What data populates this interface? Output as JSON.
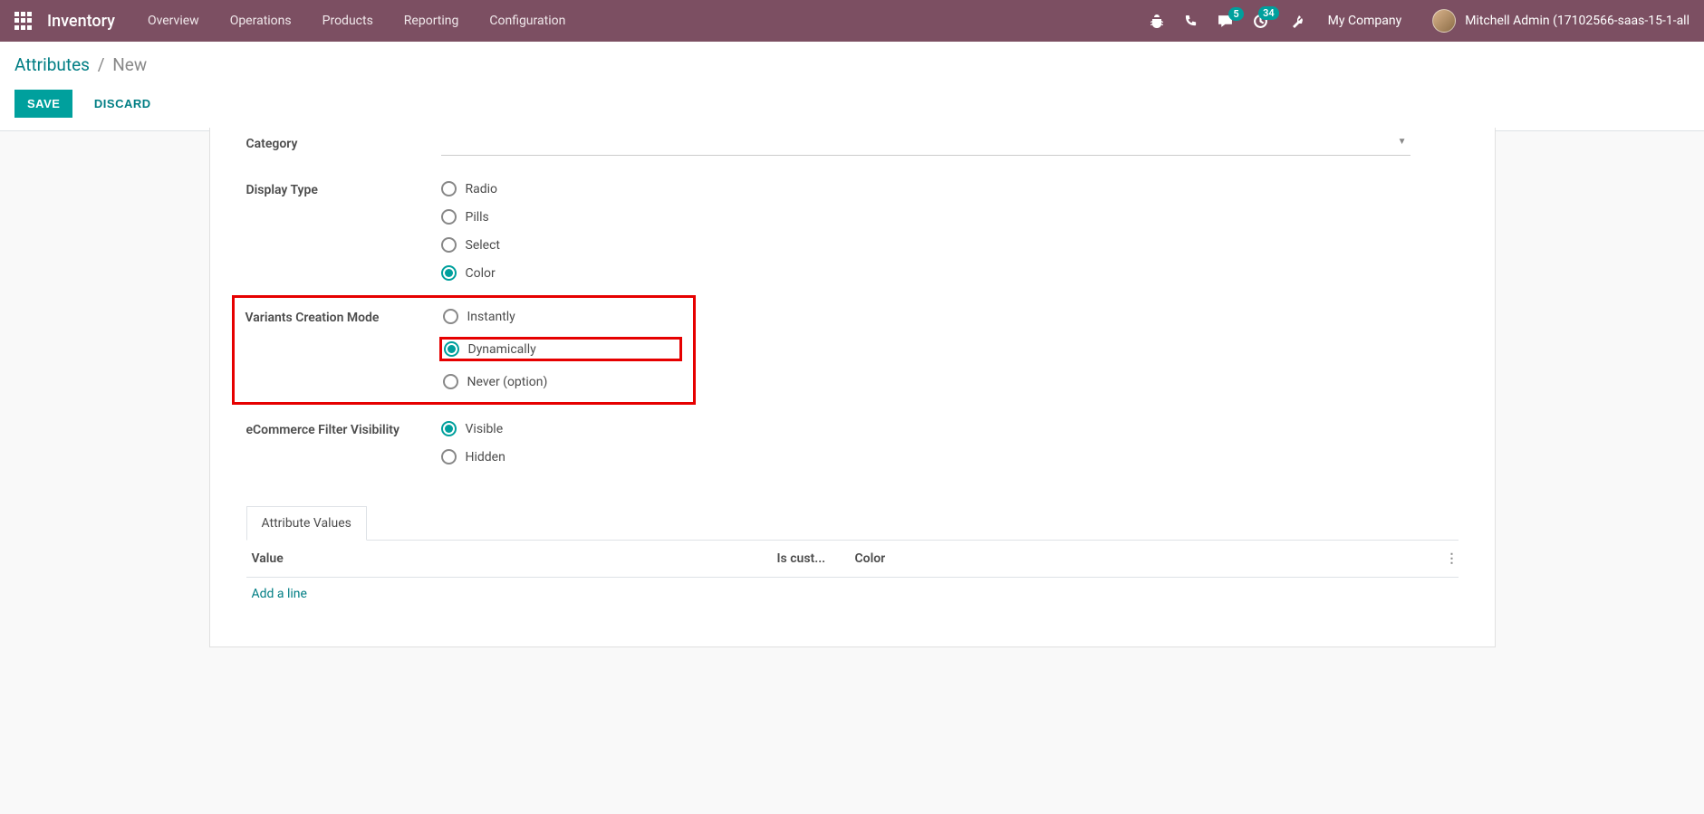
{
  "topbar": {
    "brand": "Inventory",
    "menu": [
      "Overview",
      "Operations",
      "Products",
      "Reporting",
      "Configuration"
    ],
    "msg_badge": "5",
    "activity_badge": "34",
    "company": "My Company",
    "user": "Mitchell Admin (17102566-saas-15-1-all"
  },
  "breadcrumb": {
    "root": "Attributes",
    "current": "New"
  },
  "actions": {
    "save": "SAVE",
    "discard": "DISCARD"
  },
  "form": {
    "category_label": "Category",
    "display_type_label": "Display Type",
    "display_type_options": [
      "Radio",
      "Pills",
      "Select",
      "Color"
    ],
    "display_type_selected": "Color",
    "vcm_label": "Variants Creation Mode",
    "vcm_options": [
      "Instantly",
      "Dynamically",
      "Never (option)"
    ],
    "vcm_selected": "Dynamically",
    "efv_label": "eCommerce Filter Visibility",
    "efv_options": [
      "Visible",
      "Hidden"
    ],
    "efv_selected": "Visible"
  },
  "tab": {
    "label": "Attribute Values",
    "columns": {
      "value": "Value",
      "is_custom": "Is cust...",
      "color": "Color"
    },
    "add_line": "Add a line"
  }
}
